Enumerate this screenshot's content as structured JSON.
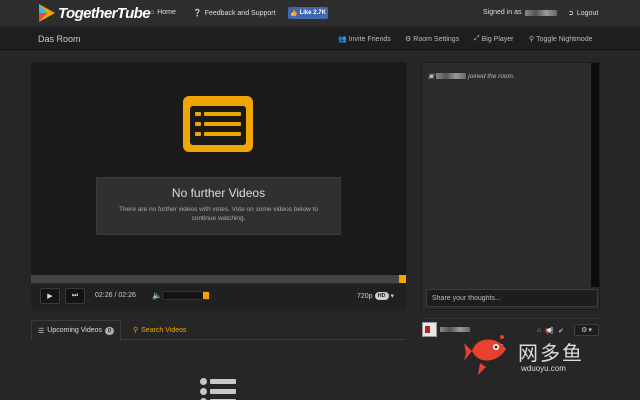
{
  "nav": {
    "brand": "TogetherTube",
    "home": "Home",
    "feedback": "Feedback and Support",
    "fb_like": "Like 2.7K",
    "signed_in_as": "Signed in as",
    "logout": "Logout"
  },
  "room": {
    "title": "Das Room",
    "invite": "Invite Friends",
    "settings": "Room Settings",
    "big_player": "Big Player",
    "nightmode": "Toggle Nightmode"
  },
  "player": {
    "no_videos_title": "No further Videos",
    "no_videos_text": "There are no further videos with votes. Vote on some videos below to continue watching.",
    "time": "02:26 / 02:26",
    "quality": "720p",
    "hd_badge": "HD",
    "progress": 1.0,
    "volume": 1.0
  },
  "chat": {
    "join_message": "joined the room.",
    "input_placeholder": "Share your thoughts..."
  },
  "tabs": {
    "upcoming": "Upcoming Videos",
    "upcoming_count": "0",
    "search": "Search Videos"
  },
  "users": {
    "partial_label": "r"
  },
  "watermark": {
    "text": "网多鱼",
    "url": "wduoyu.com"
  },
  "colors": {
    "accent": "#f0a500",
    "facebook": "#4267b2",
    "background": "#262626"
  }
}
